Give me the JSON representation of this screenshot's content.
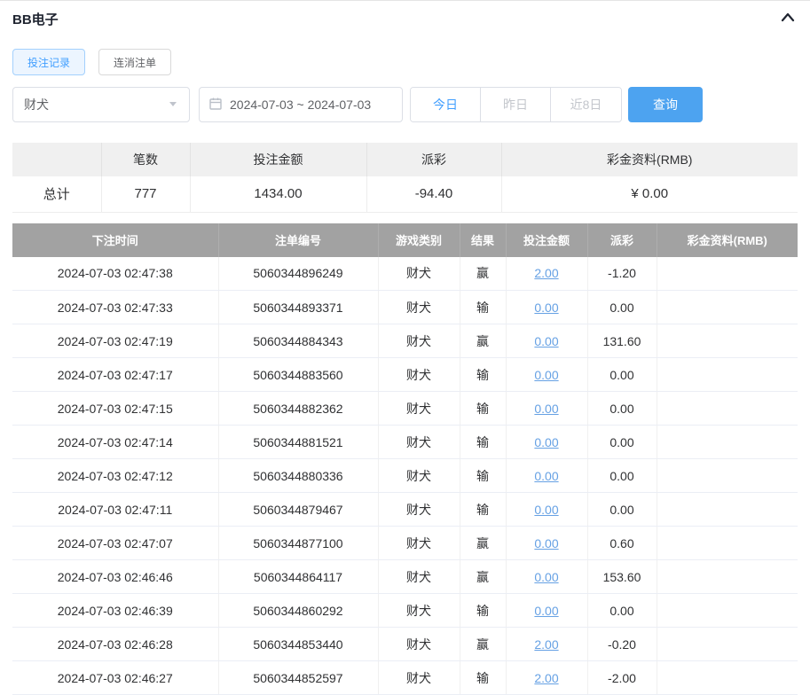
{
  "header": {
    "title": "BB电子"
  },
  "tabs": [
    {
      "label": "投注记录"
    },
    {
      "label": "连消注单"
    }
  ],
  "filters": {
    "game_select": {
      "value": "财犬"
    },
    "date_range": {
      "value": "2024-07-03 ~ 2024-07-03"
    },
    "quick_buttons": [
      {
        "label": "今日"
      },
      {
        "label": "昨日"
      },
      {
        "label": "近8日"
      }
    ],
    "search_label": "查询"
  },
  "summary": {
    "headers": [
      "",
      "笔数",
      "投注金额",
      "派彩",
      "彩金资料(RMB)"
    ],
    "row": {
      "label": "总计",
      "count": "777",
      "bet_amount": "1434.00",
      "payout": "-94.40",
      "bonus": "¥ 0.00"
    }
  },
  "table": {
    "headers": [
      "下注时间",
      "注单编号",
      "游戏类别",
      "结果",
      "投注金额",
      "派彩",
      "彩金资料(RMB)"
    ],
    "rows": [
      {
        "time": "2024-07-03 02:47:38",
        "id": "5060344896249",
        "game": "财犬",
        "result": "赢",
        "amount": "2.00",
        "payout": "-1.20",
        "bonus": ""
      },
      {
        "time": "2024-07-03 02:47:33",
        "id": "5060344893371",
        "game": "财犬",
        "result": "输",
        "amount": "0.00",
        "payout": "0.00",
        "bonus": ""
      },
      {
        "time": "2024-07-03 02:47:19",
        "id": "5060344884343",
        "game": "财犬",
        "result": "赢",
        "amount": "0.00",
        "payout": "131.60",
        "bonus": ""
      },
      {
        "time": "2024-07-03 02:47:17",
        "id": "5060344883560",
        "game": "财犬",
        "result": "输",
        "amount": "0.00",
        "payout": "0.00",
        "bonus": ""
      },
      {
        "time": "2024-07-03 02:47:15",
        "id": "5060344882362",
        "game": "财犬",
        "result": "输",
        "amount": "0.00",
        "payout": "0.00",
        "bonus": ""
      },
      {
        "time": "2024-07-03 02:47:14",
        "id": "5060344881521",
        "game": "财犬",
        "result": "输",
        "amount": "0.00",
        "payout": "0.00",
        "bonus": ""
      },
      {
        "time": "2024-07-03 02:47:12",
        "id": "5060344880336",
        "game": "财犬",
        "result": "输",
        "amount": "0.00",
        "payout": "0.00",
        "bonus": ""
      },
      {
        "time": "2024-07-03 02:47:11",
        "id": "5060344879467",
        "game": "财犬",
        "result": "输",
        "amount": "0.00",
        "payout": "0.00",
        "bonus": ""
      },
      {
        "time": "2024-07-03 02:47:07",
        "id": "5060344877100",
        "game": "财犬",
        "result": "赢",
        "amount": "0.00",
        "payout": "0.60",
        "bonus": ""
      },
      {
        "time": "2024-07-03 02:46:46",
        "id": "5060344864117",
        "game": "财犬",
        "result": "赢",
        "amount": "0.00",
        "payout": "153.60",
        "bonus": ""
      },
      {
        "time": "2024-07-03 02:46:39",
        "id": "5060344860292",
        "game": "财犬",
        "result": "输",
        "amount": "0.00",
        "payout": "0.00",
        "bonus": ""
      },
      {
        "time": "2024-07-03 02:46:28",
        "id": "5060344853440",
        "game": "财犬",
        "result": "赢",
        "amount": "2.00",
        "payout": "-0.20",
        "bonus": ""
      },
      {
        "time": "2024-07-03 02:46:27",
        "id": "5060344852597",
        "game": "财犬",
        "result": "输",
        "amount": "2.00",
        "payout": "-2.00",
        "bonus": ""
      }
    ]
  },
  "colors": {
    "accent_blue": "#409eff",
    "button_blue": "#4da3f0",
    "negative_red": "#f56c6c",
    "table_header_bg": "#a2a2a2"
  }
}
